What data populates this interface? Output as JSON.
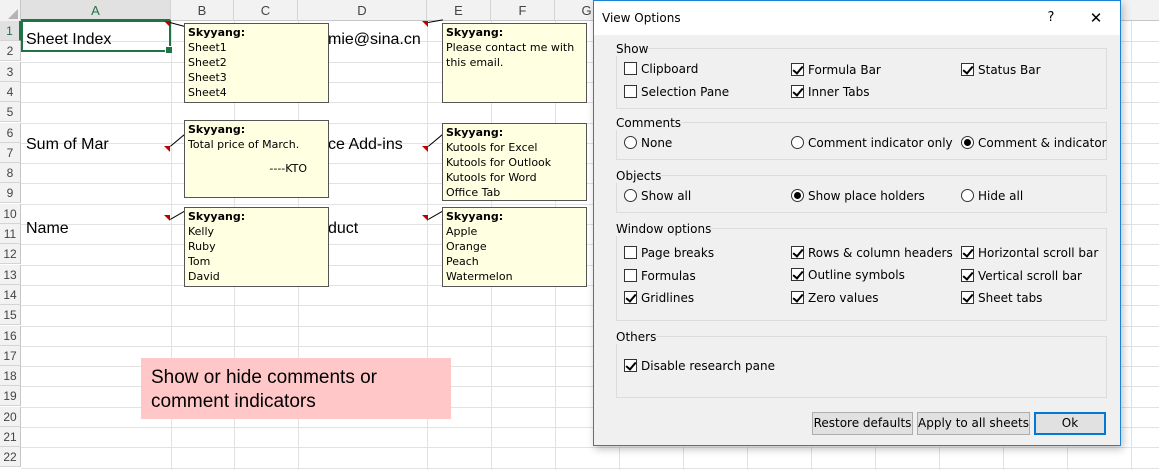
{
  "sheet": {
    "columns": [
      "A",
      "B",
      "C",
      "D",
      "E",
      "F",
      "G"
    ],
    "rows": [
      "1",
      "2",
      "3",
      "4",
      "5",
      "6",
      "7",
      "8",
      "9",
      "10",
      "11",
      "12",
      "13",
      "14",
      "15",
      "16",
      "17",
      "18",
      "19",
      "20",
      "21",
      "22"
    ],
    "cells": {
      "a1": "Sheet Index",
      "d1": "mie@sina.cn",
      "a6": "Sum of Mar",
      "d6": "ce Add-ins",
      "a10": "Name",
      "d10": "duct"
    },
    "comments": [
      {
        "author": "Skyyang:",
        "lines": [
          "Sheet1",
          "Sheet2",
          "Sheet3",
          "Sheet4"
        ]
      },
      {
        "author": "Skyyang:",
        "lines": [
          "Please contact me with",
          "this email."
        ]
      },
      {
        "author": "Skyyang:",
        "lines": [
          "Total price of March."
        ],
        "signature": "----KTO"
      },
      {
        "author": "Skyyang:",
        "lines": [
          "Kutools for Excel",
          "Kutools for Outlook",
          "Kutools for Word",
          "Office Tab"
        ]
      },
      {
        "author": "Skyyang:",
        "lines": [
          "Kelly",
          "Ruby",
          "Tom",
          "David"
        ]
      },
      {
        "author": "Skyyang:",
        "lines": [
          "Apple",
          "Orange",
          "Peach",
          "Watermelon"
        ]
      }
    ],
    "tip_lines": [
      "Show  or hide comments or",
      "comment indicators"
    ]
  },
  "dialog": {
    "title": "View Options",
    "help": "?",
    "close": "✕",
    "show": {
      "label": "Show",
      "clipboard": "Clipboard",
      "formula_bar": "Formula Bar",
      "status_bar": "Status Bar",
      "selection_pane": "Selection Pane",
      "inner_tabs": "Inner Tabs"
    },
    "comments": {
      "label": "Comments",
      "none": "None",
      "indicator_only": "Comment indicator only",
      "comment_and_indicator": "Comment & indicator"
    },
    "objects": {
      "label": "Objects",
      "show_all": "Show all",
      "placeholders": "Show place holders",
      "hide_all": "Hide all"
    },
    "window": {
      "label": "Window options",
      "page_breaks": "Page breaks",
      "row_col_headers": "Rows & column headers",
      "horizontal_scroll": "Horizontal scroll bar",
      "formulas": "Formulas",
      "outline_symbols": "Outline symbols",
      "vertical_scroll": "Vertical scroll bar",
      "gridlines": "Gridlines",
      "zero_values": "Zero values",
      "sheet_tabs": "Sheet tabs"
    },
    "others": {
      "label": "Others",
      "disable_research": "Disable research pane"
    },
    "buttons": {
      "restore": "Restore defaults",
      "apply_all": "Apply to all sheets",
      "ok": "Ok"
    }
  }
}
